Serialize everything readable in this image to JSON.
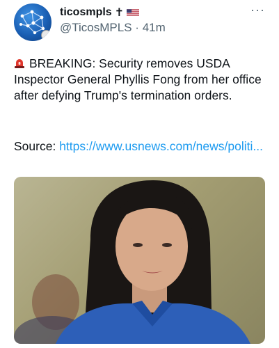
{
  "author": {
    "display_name": "ticosmpls",
    "name_suffix": "✝",
    "handle": "@TicosMPLS",
    "separator": "·",
    "time": "41m"
  },
  "icons": {
    "more": "more-options-icon",
    "siren": "siren-icon",
    "flag": "us-flag-icon"
  },
  "tweet": {
    "text": "BREAKING: Security removes USDA Inspector General Phyllis Fong from her office after defying Trump's termination orders.",
    "source_label": "Source:",
    "link_text": "https://www.usnews.com/news/politi..."
  },
  "colors": {
    "link": "#1d9bf0",
    "secondary_text": "#536471",
    "primary_text": "#0f1419"
  }
}
